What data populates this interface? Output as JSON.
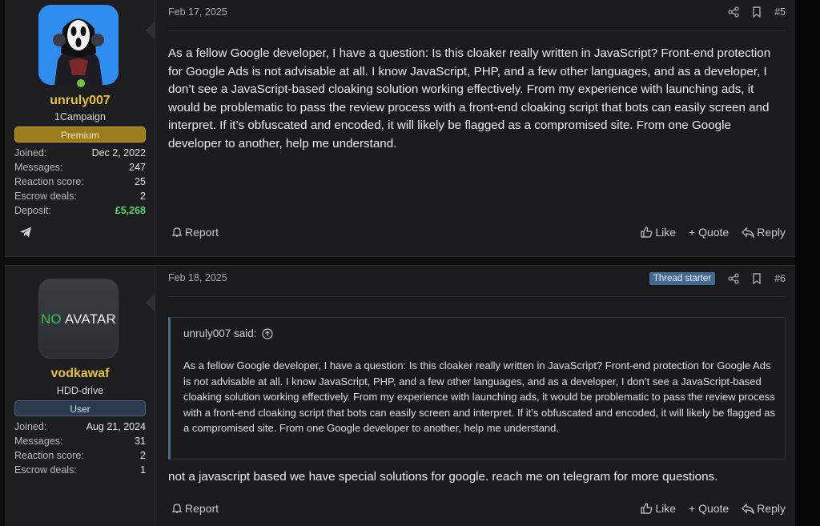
{
  "posts": [
    {
      "author": {
        "username": "unruly007",
        "user_title": "1Campaign",
        "banner": "Premium",
        "stats": [
          {
            "label": "Joined:",
            "value": "Dec 2, 2022"
          },
          {
            "label": "Messages:",
            "value": "247"
          },
          {
            "label": "Reaction score:",
            "value": "25"
          },
          {
            "label": "Escrow deals:",
            "value": "2"
          },
          {
            "label": "Deposit:",
            "value": "£5,268"
          }
        ],
        "avatar_icon": "ghostface-avatar",
        "online": true
      },
      "date": "Feb 17, 2025",
      "number": "#5",
      "body": "As a fellow Google developer, I have a question: Is this cloaker really written in JavaScript? Front-end protection for Google Ads is not advisable at all. I know JavaScript, PHP, and a few other languages, and as a developer, I don’t see a JavaScript-based cloaking solution working effectively. From my experience with launching ads, it would be problematic to pass the review process with a front-end cloaking script that bots can easily screen and interpret. If it’s obfuscated and encoded, it will likely be flagged as a compromised site. From one Google developer to another, help me understand.",
      "actions": {
        "report": "Report",
        "like": "Like",
        "quote": "+ Quote",
        "reply": "Reply"
      }
    },
    {
      "author": {
        "username": "vodkawaf",
        "user_title": "HDD-drive",
        "banner": "User",
        "avatar_text_a": "NO",
        "avatar_text_b": "AVATAR",
        "stats": [
          {
            "label": "Joined:",
            "value": "Aug 21, 2024"
          },
          {
            "label": "Messages:",
            "value": "31"
          },
          {
            "label": "Reaction score:",
            "value": "2"
          },
          {
            "label": "Escrow deals:",
            "value": "1"
          }
        ]
      },
      "date": "Feb 18, 2025",
      "number": "#6",
      "thread_starter": "Thread starter",
      "quote": {
        "header": "unruly007 said:",
        "text": "As a fellow Google developer, I have a question: Is this cloaker really written in JavaScript? Front-end protection for Google Ads is not advisable at all. I know JavaScript, PHP, and a few other languages, and as a developer, I don’t see a JavaScript-based cloaking solution working effectively. From my experience with launching ads, it would be problematic to pass the review process with a front-end cloaking script that bots can easily screen and interpret. If it’s obfuscated and encoded, it will likely be flagged as a compromised site. From one Google developer to another, help me understand."
      },
      "body": "not a javascript based we have special solutions for google. reach me on telegram for more questions.",
      "actions": {
        "report": "Report",
        "like": "Like",
        "quote": "+ Quote",
        "reply": "Reply"
      }
    }
  ],
  "colors": {
    "username": "#e2c043",
    "premium": "#9a7c1c",
    "deposit": "#5bd06a",
    "thread_starter": "#456a92"
  }
}
